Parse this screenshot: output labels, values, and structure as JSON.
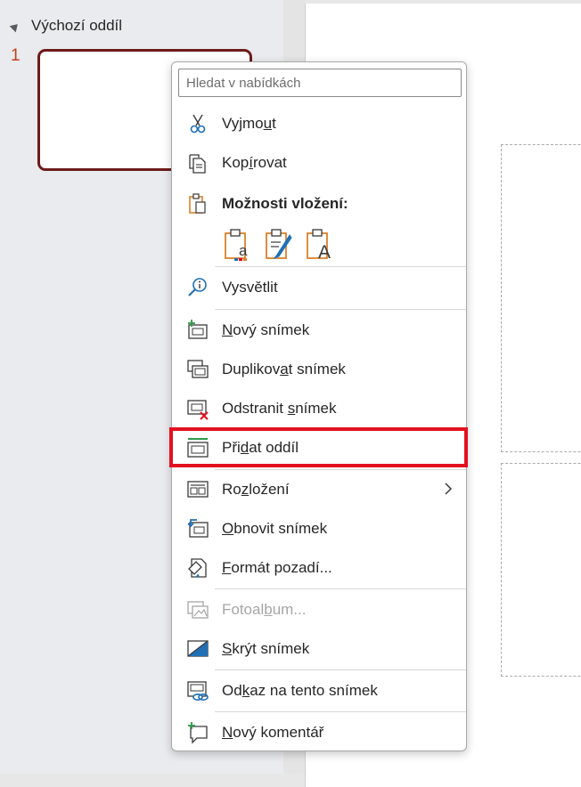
{
  "thumbnail_pane": {
    "section_title": "Výchozí oddíl",
    "slide_number": "1"
  },
  "context_menu": {
    "search_placeholder": "Hledat v nabídkách",
    "items": {
      "cut": {
        "pre": "Vyjmo",
        "key": "u",
        "post": "t"
      },
      "copy": {
        "pre": "Kop",
        "key": "í",
        "post": "rovat"
      },
      "paste_options": {
        "label": "Možnosti vložení:"
      },
      "explain": {
        "label": "Vysvětlit"
      },
      "new_slide": {
        "pre": "",
        "key": "N",
        "post": "ový snímek"
      },
      "duplicate_slide": {
        "pre": "Duplikov",
        "key": "a",
        "post": "t snímek"
      },
      "delete_slide": {
        "pre": "Odstranit ",
        "key": "s",
        "post": "nímek"
      },
      "add_section": {
        "pre": "Při",
        "key": "d",
        "post": "at oddíl"
      },
      "layout": {
        "pre": "Ro",
        "key": "z",
        "post": "ložení"
      },
      "reset_slide": {
        "pre": "",
        "key": "O",
        "post": "bnovit snímek"
      },
      "format_background": {
        "pre": "",
        "key": "F",
        "post": "ormát pozadí..."
      },
      "photo_album": {
        "pre": "Fotoal",
        "key": "b",
        "post": "um..."
      },
      "hide_slide": {
        "pre": "",
        "key": "S",
        "post": "krýt snímek"
      },
      "link_to_slide": {
        "pre": "Od",
        "key": "k",
        "post": "az na tento snímek"
      },
      "new_comment": {
        "pre": "",
        "key": "N",
        "post": "ový komentář"
      }
    },
    "icons": {
      "cut": "scissors-icon",
      "copy": "copy-icon",
      "paste": "clipboard-icon",
      "explain": "lightbulb-search-icon",
      "new_slide": "new-slide-icon",
      "duplicate_slide": "duplicate-slide-icon",
      "delete_slide": "delete-slide-icon",
      "add_section": "add-section-icon",
      "layout": "layout-icon",
      "reset_slide": "reset-slide-icon",
      "format_background": "format-background-icon",
      "photo_album": "photo-album-icon",
      "hide_slide": "hide-slide-icon",
      "link_to_slide": "link-slide-icon",
      "new_comment": "new-comment-icon"
    }
  },
  "colors": {
    "accent_red": "#e3101f",
    "thumbnail_border": "#6e1b1b",
    "slide_number": "#c43e1c",
    "icon_blue": "#1f6fb5",
    "icon_orange": "#d9822b"
  }
}
